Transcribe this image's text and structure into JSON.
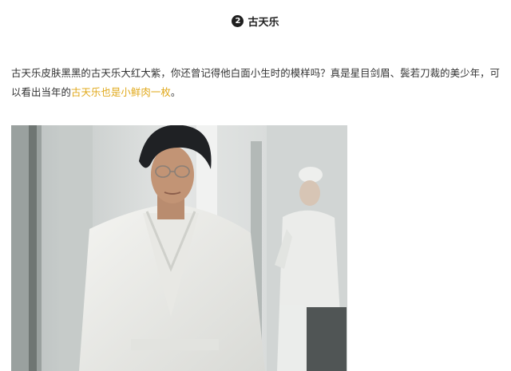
{
  "section": {
    "number": "2",
    "title": "古天乐"
  },
  "paragraph": {
    "text_before": "古天乐皮肤黑黑的古天乐大红大紫，你还曾记得他白面小生时的模样吗？真是星目剑眉、鬓若刀裁的美少年，可以看出当年的",
    "highlight": "古天乐也是小鲜肉一枚",
    "text_after": "。"
  },
  "photo": {
    "subject": "man-in-white-robe-with-glasses",
    "background_figure": "nurse-in-white"
  },
  "colors": {
    "highlight": "#e0a81a",
    "text": "#333333",
    "badge": "#1f1f1f"
  }
}
